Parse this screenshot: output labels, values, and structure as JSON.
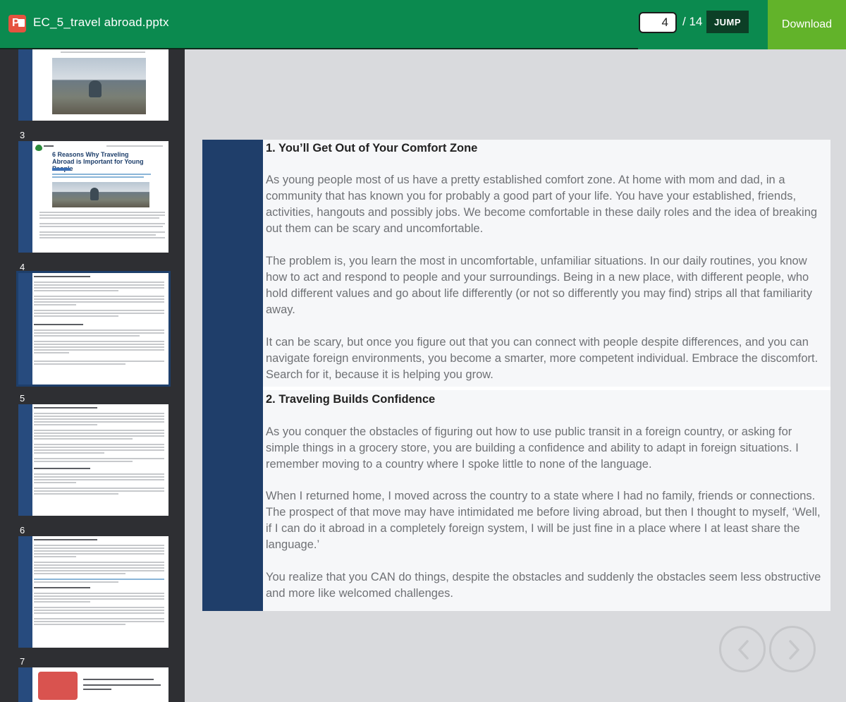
{
  "header": {
    "file_name": "EC_5_travel abroad.pptx",
    "current_page": "4",
    "total_pages": "/ 14",
    "jump_label": "JUMP",
    "download_label": "Download",
    "colors": {
      "bar": "#0b8a4f",
      "download": "#62b32a",
      "jump": "#0c3f26"
    }
  },
  "sidebar": {
    "thumbnails": [
      {
        "number": "3"
      },
      {
        "number": "4"
      },
      {
        "number": "5"
      },
      {
        "number": "6"
      },
      {
        "number": "7"
      }
    ],
    "thumb3_heading": "6 Reasons Why Traveling Abroad is Important for Young People"
  },
  "slide": {
    "section1": {
      "title": "1. You’ll Get Out of Your Comfort Zone",
      "paragraphs": [
        "As young people most of us have a pretty established comfort zone. At home with mom and dad, in a community that has known you for probably a good part of your life. You have your established, friends, activities, hangouts and possibly jobs. We become comfortable in these daily roles and the idea of breaking out them can be scary and uncomfortable.",
        "The problem is, you learn the most in uncomfortable, unfamiliar situations. In our daily routines, you know how to act and respond to people and your surroundings. Being in a new place, with different people, who hold different values and go about life differently (or not so differently you may find) strips all that familiarity away.",
        "It can be scary, but once you figure out that you can connect with people despite differences, and you can navigate foreign environments, you become a smarter, more competent individual. Embrace the discomfort. Search for it, because it is helping you grow."
      ]
    },
    "section2": {
      "title": "2. Traveling Builds Confidence",
      "paragraphs": [
        "As you conquer the obstacles of figuring out how to use public transit in a foreign country, or asking for simple things in a grocery store, you are building a confidence and ability to adapt in foreign situations. I remember moving to a country where I spoke little to none of the language.",
        "When I returned home, I moved across the country to a state where I had no family, friends or connections. The prospect of that move may have intimidated me before living abroad, but then I thought to myself, ‘Well, if I can do it abroad in a completely foreign system, I will be just fine in a place where I at least share the language.’",
        "You realize that you CAN do things, despite the obstacles and suddenly the obstacles seem less obstructive and more like welcomed challenges."
      ]
    },
    "colors": {
      "accent": "#1f3e6a",
      "text": "#6f7175",
      "title": "#222222"
    }
  },
  "icons": {
    "prev": "chevron-left-icon",
    "next": "chevron-right-icon",
    "file": "powerpoint-file-icon"
  }
}
